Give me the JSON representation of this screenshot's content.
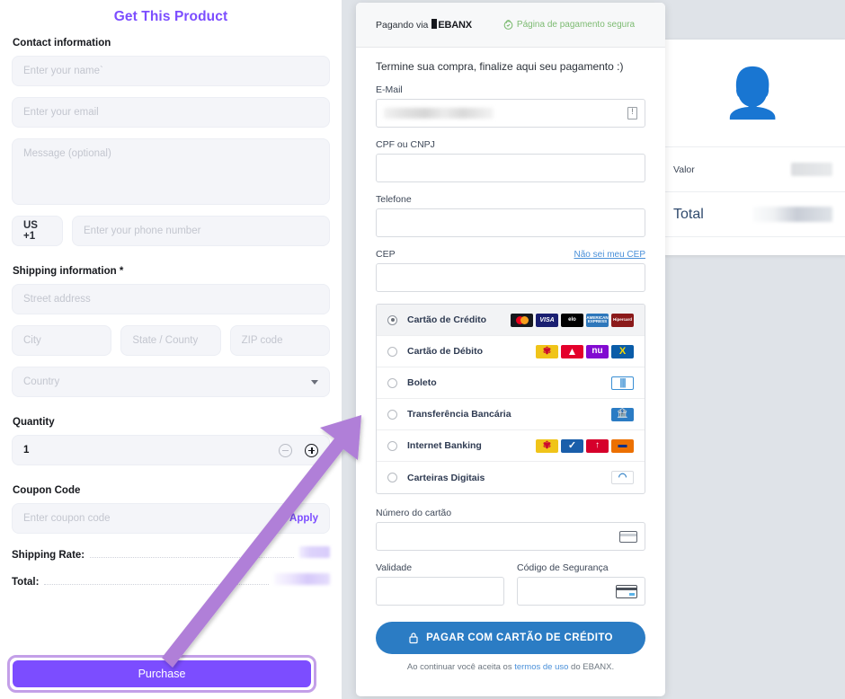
{
  "left_panel": {
    "title": "Get This Product",
    "contact_section_label": "Contact information",
    "name_placeholder": "Enter your name`",
    "email_placeholder": "Enter your email",
    "message_placeholder": "Message (optional)",
    "phone_country_code": "US +1",
    "phone_placeholder": "Enter your phone number",
    "shipping_section_label": "Shipping information *",
    "street_placeholder": "Street address",
    "city_placeholder": "City",
    "state_placeholder": "State / County",
    "zip_placeholder": "ZIP code",
    "country_placeholder": "Country",
    "quantity_label": "Quantity",
    "quantity_value": "1",
    "decrement_icon": "minus-circle-icon",
    "increment_icon": "plus-circle-icon",
    "coupon_label": "Coupon Code",
    "coupon_placeholder": "Enter coupon code",
    "apply_label": "Apply",
    "shipping_rate_label": "Shipping Rate:",
    "shipping_rate_value": "",
    "total_label": "Total:",
    "total_value": "",
    "purchase_label": "Purchase",
    "accent_color": "#7c4dff",
    "highlight_color": "#c39fe8"
  },
  "summary_card": {
    "avatar_icon": "user-avatar-icon",
    "valor_label": "Valor",
    "valor_value": "",
    "total_label": "Total",
    "total_value": ""
  },
  "ebanx_modal": {
    "header": {
      "paying_via_label": "Pagando via",
      "brand": "EBANX",
      "secure_label": "Página de pagamento segura",
      "secure_icon": "lock-icon",
      "secure_color": "#7dbb72"
    },
    "heading": "Termine sua compra, finalize aqui seu pagamento :)",
    "fields": {
      "email_label": "E-Mail",
      "email_value": "",
      "email_info_icon": "info-icon",
      "cpf_label": "CPF ou CNPJ",
      "cpf_value": "",
      "telefone_label": "Telefone",
      "telefone_value": "",
      "cep_label": "CEP",
      "cep_value": "",
      "cep_help_link": "Não sei meu CEP",
      "card_number_label": "Número do cartão",
      "card_number_value": "",
      "card_icon": "credit-card-icon",
      "validade_label": "Validade",
      "validade_value": "",
      "cvv_label": "Código de Segurança",
      "cvv_value": "",
      "cvv_icon": "card-security-code-icon"
    },
    "payment_methods": [
      {
        "id": "cartao-de-credito",
        "label": "Cartão de Crédito",
        "selected": true,
        "logos": [
          {
            "name": "mastercard-logo",
            "text": "",
            "cls": "lg-mc"
          },
          {
            "name": "visa-logo",
            "text": "VISA",
            "cls": "lg-visa"
          },
          {
            "name": "elo-logo",
            "text": "elo",
            "cls": "lg-elo"
          },
          {
            "name": "american-express-logo",
            "text": "AMERICAN EXPRESS",
            "cls": "lg-amex"
          },
          {
            "name": "hipercard-logo",
            "text": "Hipercard",
            "cls": "lg-hiper"
          }
        ]
      },
      {
        "id": "cartao-de-debito",
        "label": "Cartão de Débito",
        "selected": false,
        "logos": [
          {
            "name": "bradesco-logo",
            "text": "✾",
            "cls": "lg-bradesco"
          },
          {
            "name": "santander-logo",
            "text": "▲",
            "cls": "lg-santander"
          },
          {
            "name": "nubank-logo",
            "text": "nu",
            "cls": "lg-nubank"
          },
          {
            "name": "banco-do-brasil-logo",
            "text": "X",
            "cls": "lg-bb"
          }
        ]
      },
      {
        "id": "boleto",
        "label": "Boleto",
        "selected": false,
        "logos": [
          {
            "name": "boleto-logo",
            "text": "|||",
            "cls": "lg-boleto"
          }
        ]
      },
      {
        "id": "transferencia-bancaria",
        "label": "Transferência Bancária",
        "selected": false,
        "logos": [
          {
            "name": "bank-transfer-logo",
            "text": "🏦",
            "cls": "lg-ted"
          }
        ]
      },
      {
        "id": "internet-banking",
        "label": "Internet Banking",
        "selected": false,
        "logos": [
          {
            "name": "bradesco-logo",
            "text": "✾",
            "cls": "lg-bradesco"
          },
          {
            "name": "caixa-logo",
            "text": "✓",
            "cls": "lg-caixa"
          },
          {
            "name": "banrisul-logo",
            "text": "↑",
            "cls": "lg-banrisul"
          },
          {
            "name": "itau-logo",
            "text": "▬",
            "cls": "lg-itau"
          }
        ]
      },
      {
        "id": "carteiras-digitais",
        "label": "Carteiras Digitais",
        "selected": false,
        "logos": [
          {
            "name": "digital-wallet-logo",
            "text": "◠",
            "cls": "lg-wallet"
          }
        ]
      }
    ],
    "pay_button_label": "PAGAR COM CARTÃO DE CRÉDITO",
    "pay_button_icon": "lock-icon",
    "pay_button_color": "#2b7cc4",
    "terms_prefix": "Ao continuar você aceita os ",
    "terms_link": "termos de uso",
    "terms_suffix": " do EBANX."
  },
  "annotation": {
    "arrow_color": "#b07fd8",
    "arrow_name": "purchase-to-checkout-arrow"
  }
}
